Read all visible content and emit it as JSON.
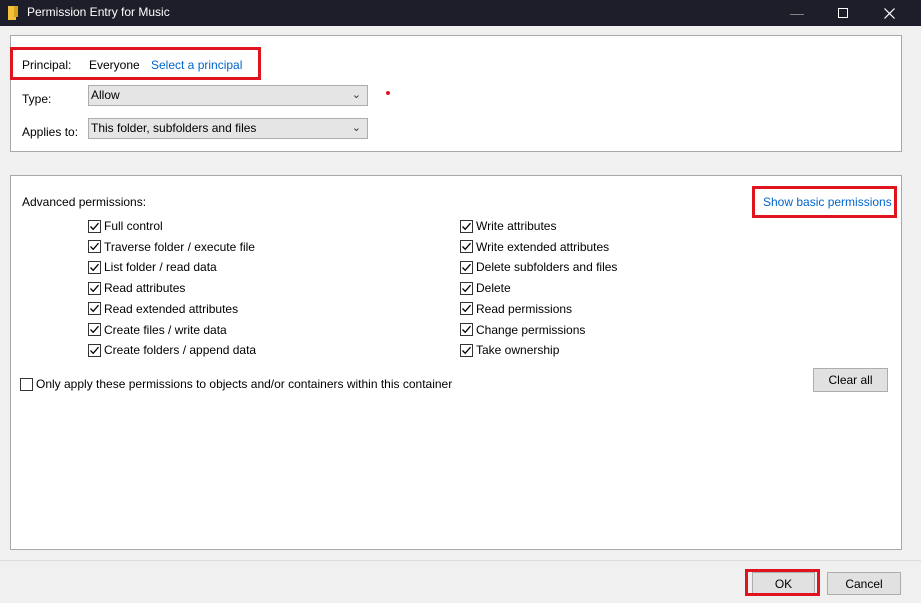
{
  "window": {
    "title": "Permission Entry for Music",
    "icon": "folder-icon",
    "controls": [
      "minimize",
      "maximize",
      "close"
    ]
  },
  "principal": {
    "label": "Principal:",
    "value": "Everyone",
    "select_link": "Select a principal"
  },
  "type": {
    "label": "Type:",
    "value": "Allow"
  },
  "applies_to": {
    "label": "Applies to:",
    "value": "This folder, subfolders and files"
  },
  "advanced": {
    "heading": "Advanced permissions:",
    "toggle_link": "Show basic permissions",
    "left_permissions": [
      {
        "label": "Full control",
        "checked": true
      },
      {
        "label": "Traverse folder / execute file",
        "checked": true
      },
      {
        "label": "List folder / read data",
        "checked": true
      },
      {
        "label": "Read attributes",
        "checked": true
      },
      {
        "label": "Read extended attributes",
        "checked": true
      },
      {
        "label": "Create files / write data",
        "checked": true
      },
      {
        "label": "Create folders / append data",
        "checked": true
      }
    ],
    "right_permissions": [
      {
        "label": "Write attributes",
        "checked": true
      },
      {
        "label": "Write extended attributes",
        "checked": true
      },
      {
        "label": "Delete subfolders and files",
        "checked": true
      },
      {
        "label": "Delete",
        "checked": true
      },
      {
        "label": "Read permissions",
        "checked": true
      },
      {
        "label": "Change permissions",
        "checked": true
      },
      {
        "label": "Take ownership",
        "checked": true
      }
    ],
    "only_apply": {
      "label": "Only apply these permissions to objects and/or containers within this container",
      "checked": false
    },
    "clear_all": "Clear all"
  },
  "footer": {
    "ok": "OK",
    "cancel": "Cancel"
  },
  "colors": {
    "highlight": "#e0141e",
    "link": "#0066cc",
    "titlebar": "#1e1e2a"
  }
}
